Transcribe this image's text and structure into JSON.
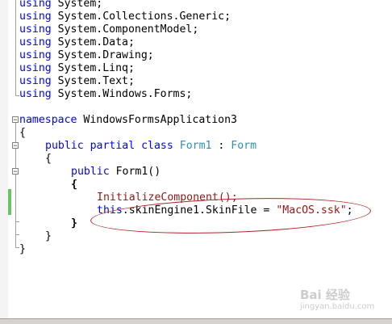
{
  "code": {
    "line1": {
      "kw": "using",
      "ns": " System;"
    },
    "line2": {
      "kw": "using",
      "ns": " System.Collections.Generic;"
    },
    "line3": {
      "kw": "using",
      "ns": " System.ComponentModel;"
    },
    "line4": {
      "kw": "using",
      "ns": " System.Data;"
    },
    "line5": {
      "kw": "using",
      "ns": " System.Drawing;"
    },
    "line6": {
      "kw": "using",
      "ns": " System.Linq;"
    },
    "line7": {
      "kw": "using",
      "ns": " System.Text;"
    },
    "line8": {
      "kw": "using",
      "ns": " System.Windows.Forms;"
    },
    "line10": {
      "kw": "namespace",
      "name": " WindowsFormsApplication3"
    },
    "line11": {
      "brace": "{"
    },
    "line12": {
      "kw1": "public",
      "kw2": " partial",
      "kw3": " class",
      "type": " Form1",
      "colon": " :",
      "base": " Form"
    },
    "line13": {
      "brace": "{"
    },
    "line14": {
      "kw": "public",
      "name": " Form1()"
    },
    "line15": {
      "brace": "{"
    },
    "line16": {
      "call": "InitializeComponent();"
    },
    "line17": {
      "kw": "this",
      "member": ".skinEngine1.SkinFile = ",
      "str": "\"MacOS.ssk\"",
      "end": ";"
    },
    "line18": {
      "brace": "}"
    },
    "line19": {
      "brace": "}"
    },
    "line20": {
      "brace": "}"
    }
  },
  "watermark": {
    "text": "Bai 经验",
    "url": "jingyan.baidu.com"
  },
  "colors": {
    "keyword": "#0000ff",
    "type": "#2b91af",
    "string": "#a31515",
    "annotation": "#b22222",
    "changebar": "#69c469"
  }
}
